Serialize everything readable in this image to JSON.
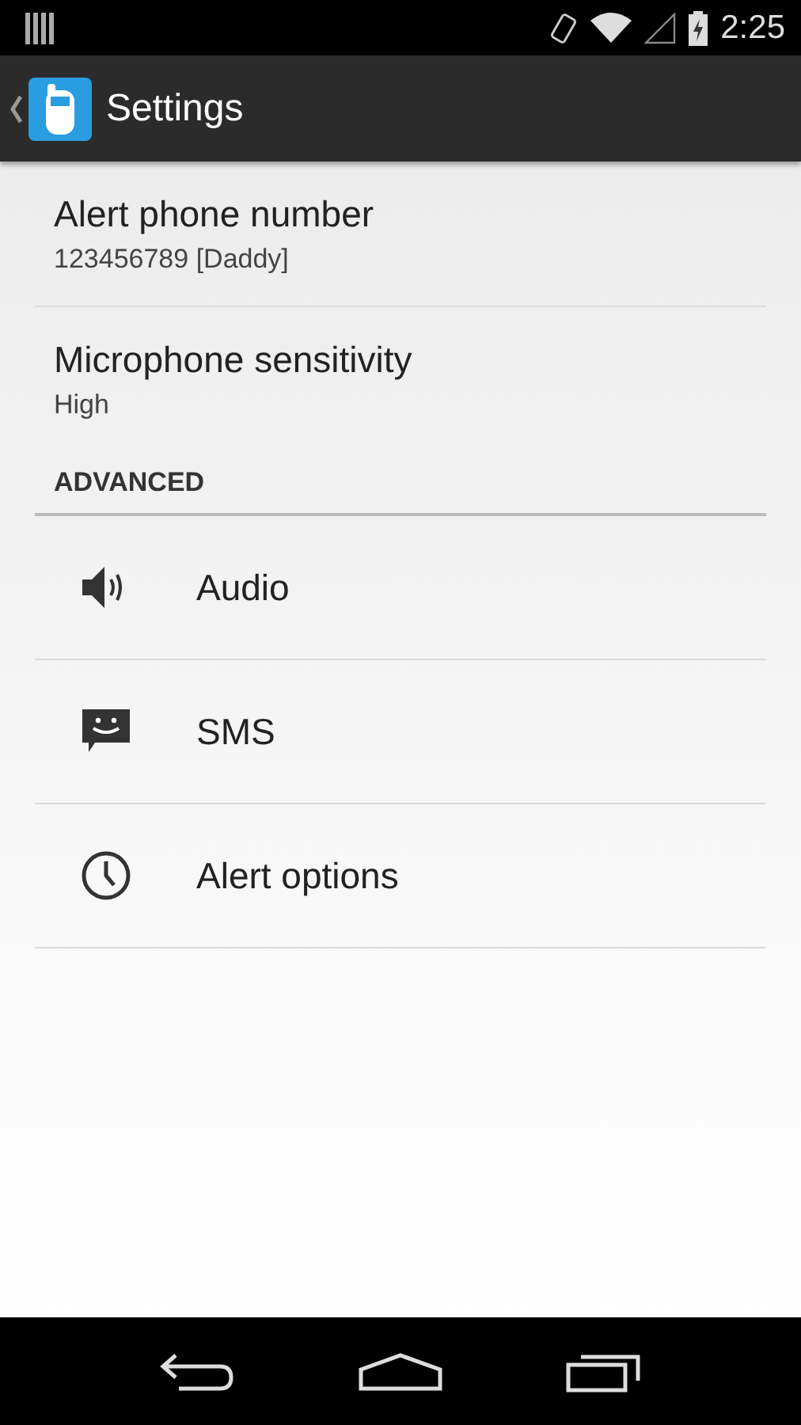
{
  "status_bar": {
    "time": "2:25"
  },
  "action_bar": {
    "title": "Settings"
  },
  "preferences": [
    {
      "title": "Alert phone number",
      "summary": "123456789 [Daddy]"
    },
    {
      "title": "Microphone sensitivity",
      "summary": "High"
    }
  ],
  "section": {
    "header": "ADVANCED",
    "items": [
      {
        "title": "Audio"
      },
      {
        "title": "SMS"
      },
      {
        "title": "Alert options"
      }
    ]
  }
}
